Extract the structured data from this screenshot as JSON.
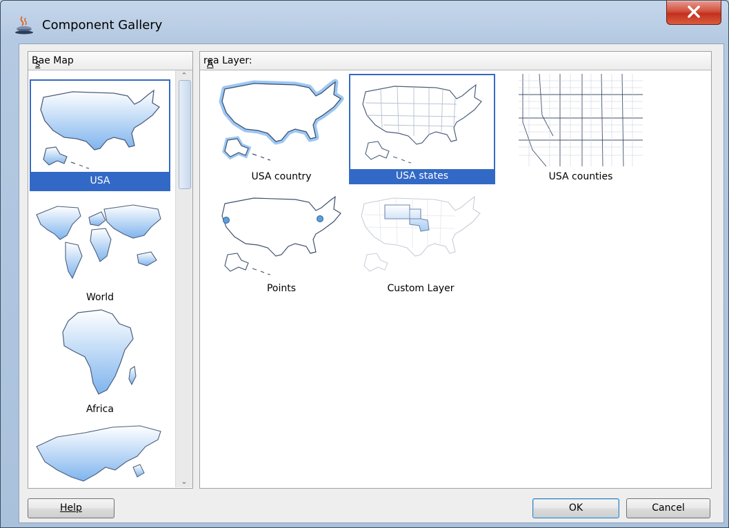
{
  "window": {
    "title": "Component Gallery",
    "app_icon": "java-cup-icon",
    "close_icon": "close-icon"
  },
  "base_map": {
    "header": "Base Map",
    "items": [
      {
        "label": "USA",
        "selected": true
      },
      {
        "label": "World"
      },
      {
        "label": "Africa"
      },
      {
        "label": ""
      }
    ]
  },
  "area_layer": {
    "header": "Area Layer:",
    "items": [
      {
        "label": "USA country"
      },
      {
        "label": "USA states",
        "selected": true
      },
      {
        "label": "USA counties"
      },
      {
        "label": "Points"
      },
      {
        "label": "Custom Layer"
      }
    ]
  },
  "buttons": {
    "help": "Help",
    "ok": "OK",
    "cancel": "Cancel"
  },
  "colors": {
    "selection": "#3369c6",
    "map_fill_top": "#ffffff",
    "map_fill_bottom": "#7fb4ee",
    "close_button": "#c3301d"
  }
}
